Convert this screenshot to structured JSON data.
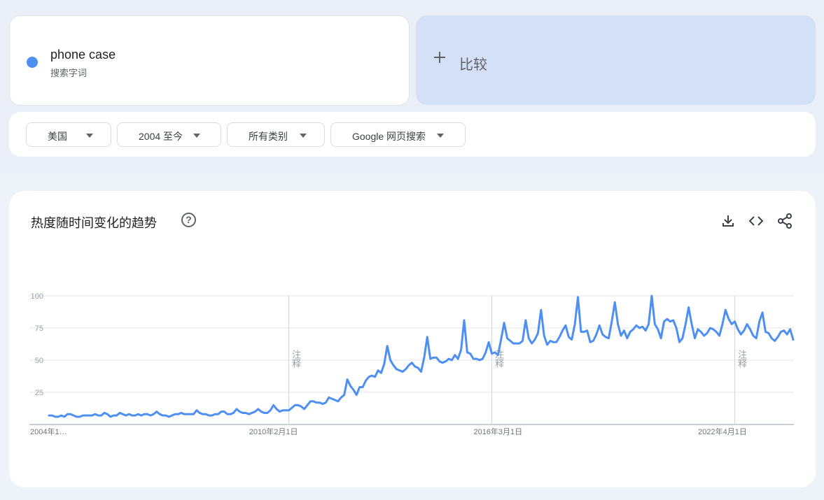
{
  "term": {
    "name": "phone case",
    "type": "搜索字词",
    "color": "#4e8ff2"
  },
  "compare": {
    "label": "比较"
  },
  "filters": [
    {
      "label": "美国"
    },
    {
      "label": "2004 至今"
    },
    {
      "label": "所有类别"
    },
    {
      "label": "Google 网页搜索"
    }
  ],
  "chart_header": {
    "title": "热度随时间变化的趋势",
    "help_glyph": "?",
    "icons": [
      "download-icon",
      "embed-code-icon",
      "share-icon"
    ]
  },
  "chart_data": {
    "type": "line",
    "title": "",
    "xlabel": "",
    "ylabel": "",
    "ylim": [
      0,
      100
    ],
    "yticks": [
      25,
      50,
      75,
      100
    ],
    "grid": true,
    "x_start_label": "2004年1…",
    "x_ticks": [
      {
        "label": "2010年2月1日",
        "month_index": 73
      },
      {
        "label": "2016年3月1日",
        "month_index": 146
      },
      {
        "label": "2022年4月1日",
        "month_index": 219
      }
    ],
    "annotations": [
      {
        "label": "注释",
        "month_index": 78
      },
      {
        "label": "注释",
        "month_index": 144
      },
      {
        "label": "注释",
        "month_index": 223
      }
    ],
    "line_color": "#4e8ff2",
    "series": [
      {
        "values": [
          7,
          7,
          6,
          6,
          7,
          6,
          8,
          8,
          7,
          6,
          6,
          7,
          7,
          7,
          7,
          8,
          7,
          7,
          9,
          8,
          6,
          7,
          7,
          9,
          8,
          7,
          8,
          7,
          7,
          8,
          7,
          8,
          8,
          7,
          8,
          10,
          8,
          7,
          7,
          6,
          7,
          8,
          8,
          9,
          8,
          8,
          8,
          8,
          11,
          9,
          8,
          8,
          7,
          7,
          8,
          8,
          10,
          10,
          8,
          8,
          9,
          12,
          10,
          9,
          9,
          8,
          9,
          10,
          12,
          10,
          9,
          9,
          11,
          15,
          12,
          10,
          11,
          11,
          11,
          13,
          15,
          15,
          14,
          12,
          15,
          18,
          18,
          17,
          17,
          16,
          17,
          21,
          20,
          19,
          18,
          21,
          23,
          35,
          30,
          27,
          23,
          29,
          29,
          34,
          37,
          38,
          37,
          42,
          40,
          47,
          61,
          50,
          46,
          43,
          42,
          41,
          43,
          46,
          48,
          45,
          44,
          41,
          52,
          68,
          51,
          52,
          52,
          49,
          48,
          49,
          51,
          50,
          54,
          51,
          58,
          81,
          56,
          55,
          51,
          51,
          50,
          51,
          56,
          64,
          55,
          56,
          54,
          66,
          79,
          67,
          65,
          63,
          63,
          63,
          65,
          81,
          67,
          63,
          66,
          71,
          89,
          69,
          62,
          65,
          64,
          64,
          68,
          73,
          77,
          68,
          66,
          78,
          99,
          72,
          72,
          73,
          64,
          65,
          70,
          77,
          70,
          68,
          67,
          80,
          95,
          78,
          69,
          73,
          67,
          72,
          74,
          77,
          75,
          76,
          73,
          78,
          100,
          78,
          74,
          67,
          80,
          82,
          80,
          81,
          75,
          64,
          67,
          78,
          91,
          78,
          67,
          74,
          72,
          69,
          71,
          75,
          74,
          72,
          69,
          78,
          89,
          82,
          78,
          80,
          74,
          70,
          73,
          78,
          74,
          69,
          67,
          80,
          87,
          72,
          71,
          67,
          65,
          68,
          72,
          73,
          70,
          74,
          66
        ]
      }
    ]
  }
}
